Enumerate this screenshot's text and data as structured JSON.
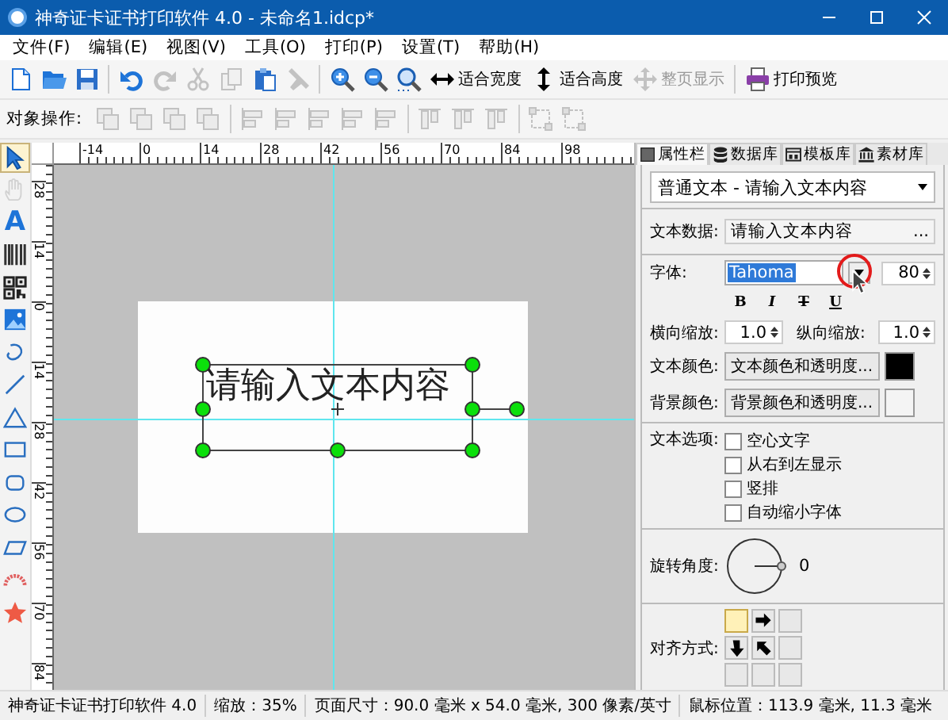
{
  "window": {
    "title": "神奇证卡证书打印软件 4.0 - 未命名1.idcp*"
  },
  "menu": [
    "文件(F)",
    "编辑(E)",
    "视图(V)",
    "工具(O)",
    "打印(P)",
    "设置(T)",
    "帮助(H)"
  ],
  "toolbar": [
    {
      "kind": "new",
      "disabled": false
    },
    {
      "kind": "open",
      "disabled": false
    },
    {
      "kind": "save",
      "disabled": false
    },
    {
      "kind": "sep"
    },
    {
      "kind": "undo",
      "disabled": false
    },
    {
      "kind": "redo",
      "disabled": true
    },
    {
      "kind": "cut",
      "disabled": true
    },
    {
      "kind": "copy",
      "disabled": true
    },
    {
      "kind": "paste",
      "disabled": false
    },
    {
      "kind": "tool",
      "disabled": true
    },
    {
      "kind": "sep"
    },
    {
      "kind": "zoomin",
      "disabled": false
    },
    {
      "kind": "zoomout",
      "disabled": false
    },
    {
      "kind": "zoomfit",
      "disabled": false
    },
    {
      "kind": "fit-width",
      "label": "适合宽度",
      "disabled": false
    },
    {
      "kind": "fit-height",
      "label": "适合高度",
      "disabled": false
    },
    {
      "kind": "full-page",
      "label": "整页显示",
      "disabled": true
    },
    {
      "kind": "sep"
    },
    {
      "kind": "print",
      "label": "打印预览",
      "disabled": false
    }
  ],
  "object_toolbar": {
    "label": "对象操作:",
    "tools": [
      {
        "kind": "arrange",
        "disabled": true
      },
      {
        "kind": "arrange",
        "disabled": true
      },
      {
        "kind": "arrange",
        "disabled": true
      },
      {
        "kind": "arrange",
        "disabled": true
      },
      {
        "kind": "sep"
      },
      {
        "kind": "align-h",
        "disabled": true
      },
      {
        "kind": "align-h",
        "disabled": true
      },
      {
        "kind": "align-h",
        "disabled": true
      },
      {
        "kind": "align-h",
        "disabled": true
      },
      {
        "kind": "align-h",
        "disabled": true
      },
      {
        "kind": "sep"
      },
      {
        "kind": "align-v",
        "disabled": true
      },
      {
        "kind": "align-v",
        "disabled": true
      },
      {
        "kind": "align-v",
        "disabled": true
      },
      {
        "kind": "sep"
      },
      {
        "kind": "resize",
        "disabled": true
      },
      {
        "kind": "resize",
        "disabled": true
      }
    ]
  },
  "tools": [
    {
      "kind": "pointer",
      "selected": true,
      "disabled": false
    },
    {
      "kind": "hand",
      "selected": false,
      "disabled": true
    },
    {
      "kind": "text",
      "glyph": "A",
      "selected": false,
      "disabled": false
    },
    {
      "kind": "barcode",
      "selected": false,
      "disabled": false
    },
    {
      "kind": "qrcode",
      "selected": false,
      "disabled": false
    },
    {
      "kind": "image",
      "selected": false,
      "disabled": false
    },
    {
      "kind": "curve",
      "selected": false,
      "disabled": false
    },
    {
      "kind": "line",
      "selected": false,
      "disabled": false
    },
    {
      "kind": "triangle",
      "selected": false,
      "disabled": false
    },
    {
      "kind": "rect",
      "selected": false,
      "disabled": false
    },
    {
      "kind": "roundrect",
      "selected": false,
      "disabled": false
    },
    {
      "kind": "ellipse",
      "selected": false,
      "disabled": false
    },
    {
      "kind": "parallelogram",
      "selected": false,
      "disabled": false
    },
    {
      "kind": "arc",
      "selected": false,
      "disabled": false
    },
    {
      "kind": "star",
      "selected": false,
      "disabled": false
    }
  ],
  "rulers": {
    "horizontal": [
      "-14",
      "0",
      "14",
      "28",
      "42",
      "56",
      "70",
      "84",
      "98"
    ],
    "vertical": [
      "28",
      "14",
      "0",
      "14",
      "28",
      "42",
      "56",
      "70",
      "84"
    ]
  },
  "canvas": {
    "text": "请输入文本内容"
  },
  "panel": {
    "tabs": [
      {
        "label": "属性栏",
        "kind": "properties",
        "selected": true
      },
      {
        "label": "数据库",
        "kind": "database",
        "selected": false
      },
      {
        "label": "模板库",
        "kind": "templates",
        "selected": false
      },
      {
        "label": "素材库",
        "kind": "materials",
        "selected": false
      }
    ],
    "object_select": "普通文本 - 请输入文本内容",
    "text_data": {
      "label": "文本数据:",
      "value": "请输入文本内容",
      "button": "..."
    },
    "font": {
      "label": "字体:",
      "value": "Tahoma",
      "size": "80"
    },
    "styles": [
      {
        "kind": "bold",
        "glyph": "B"
      },
      {
        "kind": "italic",
        "glyph": "I"
      },
      {
        "kind": "strike",
        "glyph": "T"
      },
      {
        "kind": "underline",
        "glyph": "U"
      }
    ],
    "scale": [
      {
        "label": "横向缩放:",
        "value": "1.0"
      },
      {
        "label": "纵向缩放:",
        "value": "1.0"
      }
    ],
    "colors": [
      {
        "label": "文本颜色:",
        "button": "文本颜色和透明度...",
        "color": "#000000"
      },
      {
        "label": "背景颜色:",
        "button": "背景颜色和透明度...",
        "color": "#f4f4f4"
      }
    ],
    "text_options": {
      "label": "文本选项:",
      "items": [
        {
          "label": "空心文字",
          "checked": false
        },
        {
          "label": "从右到左显示",
          "checked": false
        },
        {
          "label": "竖排",
          "checked": false
        },
        {
          "label": "自动缩小字体",
          "checked": false
        }
      ]
    },
    "rotation": {
      "label": "旋转角度:",
      "value": "0"
    },
    "alignment": {
      "label": "对齐方式:",
      "cells": [
        {
          "kind": "empty",
          "selected": true
        },
        {
          "kind": "right",
          "selected": false
        },
        {
          "kind": "empty",
          "selected": false
        },
        {
          "kind": "down",
          "selected": false
        },
        {
          "kind": "diagonal",
          "selected": false
        },
        {
          "kind": "empty",
          "selected": false
        },
        {
          "kind": "empty",
          "selected": false
        },
        {
          "kind": "empty",
          "selected": false
        },
        {
          "kind": "empty",
          "selected": false
        }
      ]
    }
  },
  "status_bar": [
    "神奇证卡证书打印软件 4.0",
    "缩放：35%",
    "页面尺寸：90.0 毫米 x 54.0 毫米, 300 像素/英寸",
    "鼠标位置：113.9 毫米, 11.3 毫米"
  ]
}
